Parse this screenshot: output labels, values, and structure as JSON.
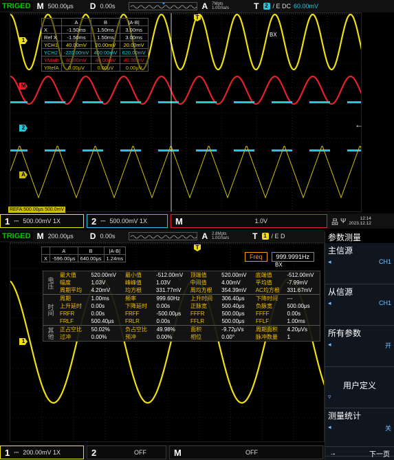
{
  "screen1": {
    "top": {
      "trig": "TRIGED",
      "m_label": "M",
      "timebase": "500.00μs",
      "d_label": "D",
      "delay": "0.00s",
      "acq_label": "A",
      "mpts": "7Mpts",
      "rate": "1.0GSa/s",
      "t_label": "T",
      "trig_ch": "2",
      "trig_info": "/ E DC",
      "trig_level": "60.00mV"
    },
    "cursor_table": {
      "header": [
        "",
        "A",
        "B",
        "|A-B|"
      ],
      "rows": [
        [
          "X",
          "-1.50ms",
          "1.50ms",
          "3.00ms"
        ],
        [
          "Ref X",
          "-1.50ms",
          "1.50ms",
          "3.00ms"
        ],
        [
          "YCH1",
          "40.00mV",
          "20.00mV",
          "20.00mV"
        ],
        [
          "YCH2",
          "-220.00mV",
          "400.00mV",
          "620.00mV"
        ],
        [
          "YMath",
          "80.00mV",
          "40.00mV",
          "40.00mV"
        ],
        [
          "YRefA",
          "0.00μV",
          "0.00μV",
          "0.00μV"
        ]
      ]
    },
    "bx_label": "BX",
    "ref_label": "REFA:500.00μs 500.0mV",
    "ch_markers": {
      "ch1": "1",
      "math": "M",
      "ch2": "2",
      "ref": "A",
      "trig": "T"
    },
    "bottom": {
      "ch1_num": "1",
      "ch1_val": "500.00mV 1X",
      "ch2_num": "2",
      "ch2_val": "500.00mV 1X",
      "m_label": "M",
      "m_val": "1.0V",
      "time": "12:14",
      "date": "2023.12.12"
    }
  },
  "screen2": {
    "top": {
      "trig": "TRIGED",
      "m_label": "M",
      "timebase": "200.00μs",
      "d_label": "D",
      "delay": "0.00s",
      "acq_label": "A",
      "mpts": "2.8Mpts",
      "rate": "1.0GSa/s",
      "t_label": "T",
      "trig_ch": "1",
      "trig_info": "/ E D"
    },
    "cursor_table": {
      "header": [
        "",
        "A",
        "B",
        "|A-B|"
      ],
      "rows": [
        [
          "X",
          "-596.00μs",
          "640.00μs",
          "1.24ms"
        ]
      ]
    },
    "freq": {
      "label": "Freq",
      "value": "999.9991Hz"
    },
    "bx_label": "BX",
    "measurements": {
      "group_voltage": "电压",
      "group_time": "时间",
      "group_other": "其他",
      "voltage_rows": [
        [
          "最大值",
          "520.00mV",
          "最小值",
          "-512.00mV",
          "顶端值",
          "520.00mV",
          "底端值",
          "-512.00mV"
        ],
        [
          "幅度",
          "1.03V",
          "峰峰值",
          "1.03V",
          "中间值",
          "4.00mV",
          "平均值",
          "-7.99mV"
        ],
        [
          "周期平均",
          "4.20mV",
          "均方根",
          "331.77mV",
          "周均方根",
          "354.39mV",
          "AC均方根",
          "331.67mV"
        ]
      ],
      "time_rows": [
        [
          "周期",
          "1.00ms",
          "频率",
          "999.60Hz",
          "上升时间",
          "306.40μs",
          "下降时间",
          "---"
        ],
        [
          "上升延时",
          "0.00s",
          "下降延时",
          "0.00s",
          "正脉宽",
          "500.40μs",
          "负脉宽",
          "500.00μs"
        ],
        [
          "FRFR",
          "0.00s",
          "FRFF",
          "-500.00μs",
          "FFFR",
          "500.00μs",
          "FFFF",
          "0.00s"
        ],
        [
          "FRLF",
          "500.40μs",
          "FRLR",
          "0.00s",
          "FFLR",
          "500.00μs",
          "FFLF",
          "1.00ms"
        ]
      ],
      "other_rows": [
        [
          "正占空比",
          "50.02%",
          "负占空比",
          "49.98%",
          "面积",
          "-9.72μVs",
          "周期面积",
          "4.20μVs"
        ],
        [
          "过冲",
          "0.00%",
          "预冲",
          "0.00%",
          "相位",
          "0.00°",
          "脉冲数量",
          "1"
        ]
      ]
    },
    "menu": {
      "title": "参数测量",
      "items": [
        {
          "title": "主信源",
          "arrow": "◂",
          "value": "CH1"
        },
        {
          "title": "从信源",
          "arrow": "◂",
          "value": "CH1"
        },
        {
          "title": "所有参数",
          "arrow": "◂",
          "value": "开"
        },
        {
          "title": "用户定义",
          "arrow": "▿",
          "value": ""
        },
        {
          "title": "测量统计",
          "arrow": "◂",
          "value": "关"
        }
      ],
      "next_arrow": "→",
      "next": "下一页"
    },
    "bottom": {
      "ch1_num": "1",
      "ch1_val": "200.00mV 1X",
      "ch2_num": "2",
      "ch2_val": "OFF",
      "m_label": "M",
      "m_val": "OFF"
    }
  },
  "colors": {
    "ch1": "#f0e010",
    "ch2": "#26c6da",
    "math": "#e8202a",
    "ref": "#cdbf10",
    "grid": "#333333"
  }
}
